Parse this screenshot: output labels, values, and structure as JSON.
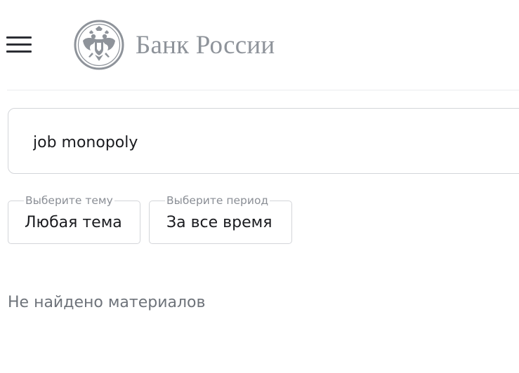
{
  "header": {
    "menu_icon": "hamburger-menu-icon",
    "logo_icon": "double-headed-eagle-emblem",
    "logo_text": "Банк России"
  },
  "search": {
    "value": "job monopoly"
  },
  "filters": {
    "topic": {
      "label": "Выберите тему",
      "value": "Любая тема"
    },
    "period": {
      "label": "Выберите период",
      "value": "За все время"
    }
  },
  "results": {
    "empty_message": "Не найдено материалов"
  },
  "colors": {
    "logo_gray": "#8e939a",
    "border": "#d3d5d9",
    "text_primary": "#1a1b1f",
    "text_secondary": "#6e737a"
  }
}
